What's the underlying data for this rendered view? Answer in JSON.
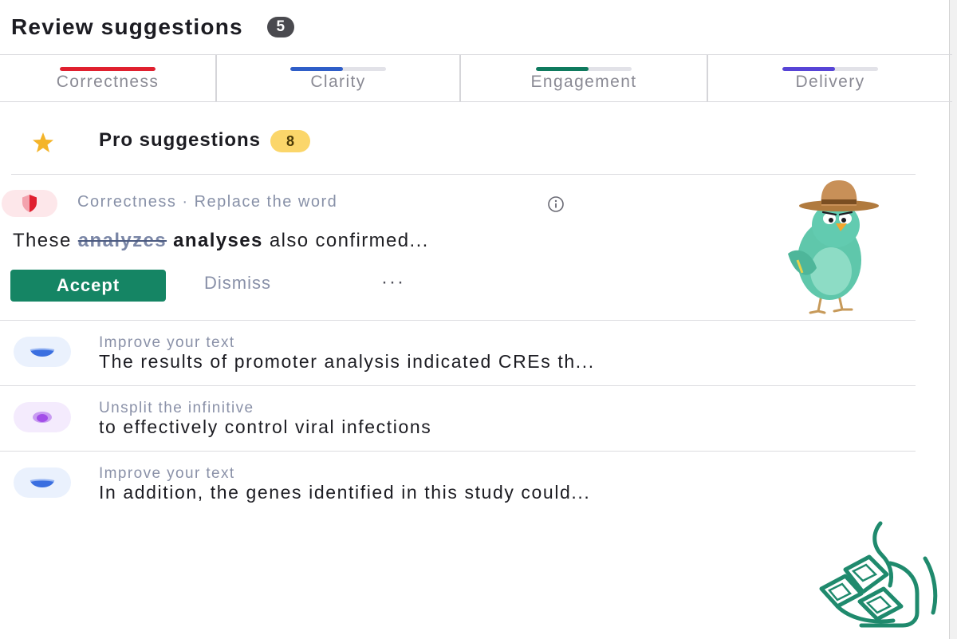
{
  "header": {
    "title": "Review suggestions",
    "count": "5"
  },
  "tabs": [
    {
      "label": "Correctness",
      "color": "#e0202f"
    },
    {
      "label": "Clarity",
      "color": "#2f5ec8"
    },
    {
      "label": "Engagement",
      "color": "#0f7a5e"
    },
    {
      "label": "Delivery",
      "color": "#5744d6"
    }
  ],
  "pro": {
    "title": "Pro suggestions",
    "count": "8"
  },
  "card": {
    "category": "Correctness · Replace the word",
    "sentence_prefix": "These ",
    "struck_word": "analyzes",
    "replacement_word": "analyses",
    "sentence_suffix": " also confirmed...",
    "accept_label": "Accept",
    "dismiss_label": "Dismiss",
    "more_label": "···"
  },
  "suggestions": [
    {
      "category": "Improve your text",
      "text": "The results of promoter analysis indicated CREs th...",
      "icon": "clarity-icon",
      "color": "#3b6fe0"
    },
    {
      "category": "Unsplit the infinitive",
      "text": "to effectively control viral infections",
      "icon": "delivery-icon",
      "color": "#a24ee8"
    },
    {
      "category": "Improve your text",
      "text": "In addition, the genes identified in this study could...",
      "icon": "clarity-icon",
      "color": "#3b6fe0"
    }
  ],
  "colors": {
    "accent": "#158564",
    "pro_badge": "#fbd66a"
  }
}
